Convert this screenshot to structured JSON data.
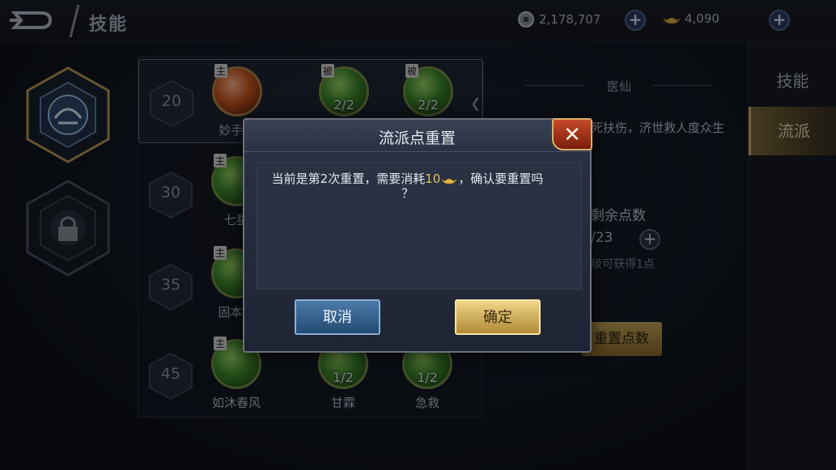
{
  "topbar": {
    "title": "技能",
    "coins": "2,178,707",
    "gold": "4,090"
  },
  "tree": {
    "tiers": [
      {
        "level": "20",
        "skills": [
          {
            "tag": "主",
            "name": "妙手回",
            "lvl": "",
            "color": "red"
          },
          {
            "tag": "被",
            "name": "",
            "lvl": "2/2"
          },
          {
            "tag": "被",
            "name": "",
            "lvl": "2/2"
          }
        ]
      },
      {
        "level": "30",
        "skills": [
          {
            "tag": "主",
            "name": "七星",
            "lvl": ""
          }
        ]
      },
      {
        "level": "35",
        "skills": [
          {
            "tag": "主",
            "name": "固本培",
            "lvl": ""
          }
        ]
      },
      {
        "level": "45",
        "skills": [
          {
            "tag": "主",
            "name": "如沐春风",
            "lvl": ""
          },
          {
            "tag": "",
            "name": "甘霖",
            "lvl": "1/2"
          },
          {
            "tag": "",
            "name": "急救",
            "lvl": "1/2"
          }
        ]
      }
    ]
  },
  "info": {
    "sect_name": "医仙",
    "sect_desc": "死扶伤，济世救人度众生",
    "remaining_label": "剩余点数",
    "remaining_value": "/23",
    "hint": "级可获得1点",
    "reset_button": "重置点数"
  },
  "side_tabs": [
    "技能",
    "流派"
  ],
  "dialog": {
    "title": "流派点重置",
    "close": "✕",
    "message_before": "当前是第2次重置，需要消耗",
    "cost": "10",
    "message_after": "，确认要重置吗",
    "message_tail": "？",
    "cancel": "取消",
    "confirm": "确定"
  }
}
